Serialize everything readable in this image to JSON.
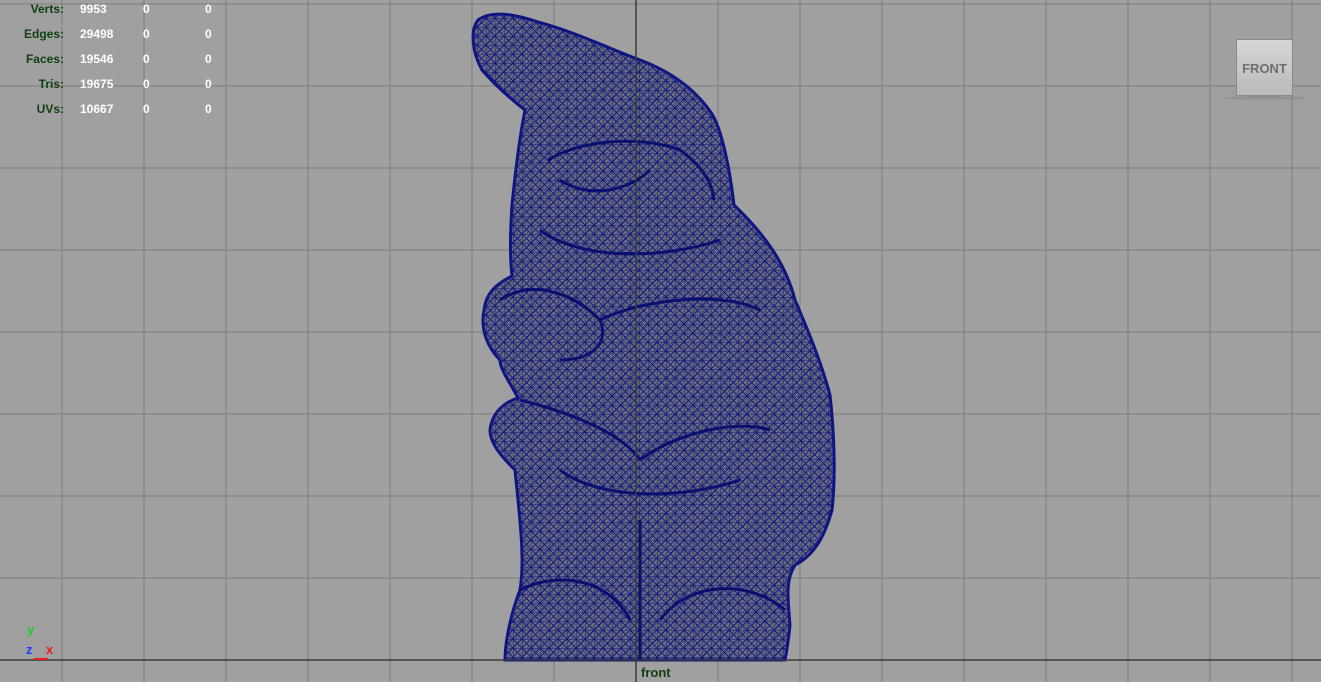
{
  "hud": {
    "stats": [
      {
        "label": "Verts:",
        "values": [
          "9953",
          "0",
          "0"
        ]
      },
      {
        "label": "Edges:",
        "values": [
          "29498",
          "0",
          "0"
        ]
      },
      {
        "label": "Faces:",
        "values": [
          "19546",
          "0",
          "0"
        ]
      },
      {
        "label": "Tris:",
        "values": [
          "19675",
          "0",
          "0"
        ]
      },
      {
        "label": "UVs:",
        "values": [
          "10667",
          "0",
          "0"
        ]
      }
    ]
  },
  "view_cube": {
    "label": "FRONT"
  },
  "camera": {
    "name": "front"
  },
  "axis_indicator": {
    "y": "y",
    "z": "z",
    "x": "x"
  },
  "colors": {
    "background": "#a0a0a0",
    "grid_line": "#7d7d7d",
    "axis_line": "#3a3a3a",
    "mesh_wire": "#0d1580",
    "mesh_fill": "#6a6a78",
    "hud_label": "#0f3f12",
    "hud_value": "#ffffff"
  }
}
